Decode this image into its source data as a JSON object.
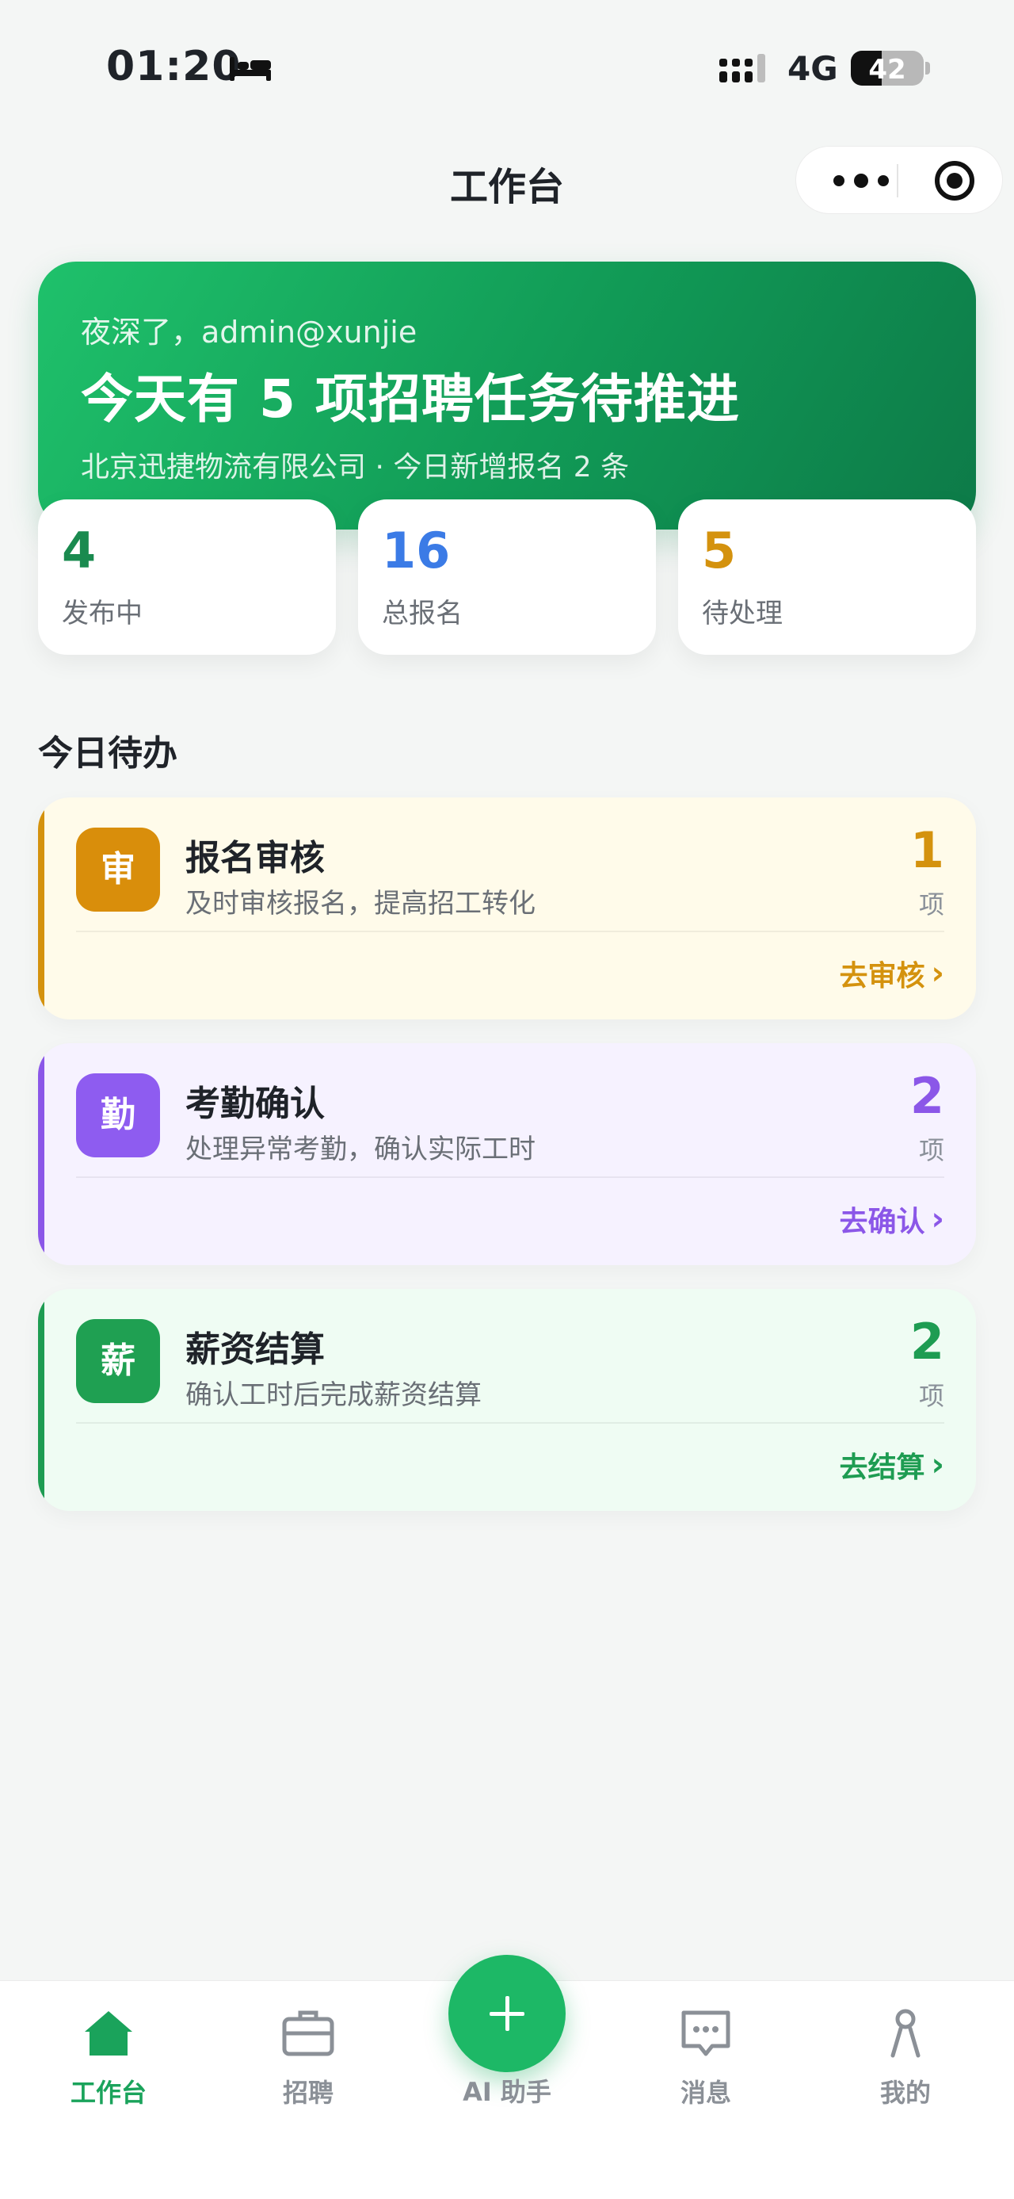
{
  "status_bar": {
    "time": "01:20",
    "sleep_icon": "bed-icon",
    "network": "4G",
    "battery": "42",
    "battery_level": 0.42
  },
  "nav": {
    "title": "工作台",
    "more_icon": "more-dots-icon",
    "target_icon": "record-target-icon"
  },
  "hero": {
    "greeting": "夜深了，admin@xunjie",
    "headline": "今天有 5 项招聘任务待推进",
    "subtitle": "北京迅捷物流有限公司 · 今日新增报名 2 条",
    "colors": {
      "start": "#1fc16b",
      "end": "#0d7a48"
    }
  },
  "stats": [
    {
      "value": "4",
      "label": "发布中",
      "color": "#1a8a4f"
    },
    {
      "value": "16",
      "label": "总报名",
      "color": "#3b7be6"
    },
    {
      "value": "5",
      "label": "待处理",
      "color": "#d4920e"
    }
  ],
  "todo": {
    "section_title": "今日待办",
    "cards": [
      {
        "badge": "审",
        "title": "报名审核",
        "desc": "及时审核报名，提高招工转化",
        "count": "1",
        "unit": "项",
        "action": "去审核",
        "accent": "#d4920e",
        "bg": "#fffbea",
        "badge_bg": "#d98e0b"
      },
      {
        "badge": "勤",
        "title": "考勤确认",
        "desc": "处理异常考勤，确认实际工时",
        "count": "2",
        "unit": "项",
        "action": "去确认",
        "accent": "#8b57e8",
        "bg": "#f6f2ff",
        "badge_bg": "#8e5cf0"
      },
      {
        "badge": "薪",
        "title": "薪资结算",
        "desc": "确认工时后完成薪资结算",
        "count": "2",
        "unit": "项",
        "action": "去结算",
        "accent": "#1e9c52",
        "bg": "#effcf3",
        "badge_bg": "#1fa052"
      }
    ]
  },
  "tabbar": {
    "tabs": [
      {
        "label": "工作台",
        "icon": "home-icon",
        "active": true
      },
      {
        "label": "招聘",
        "icon": "briefcase-icon",
        "active": false
      },
      {
        "label": "AI 助手",
        "icon": "plus-icon",
        "active": false
      },
      {
        "label": "消息",
        "icon": "chat-bubble-icon",
        "active": false
      },
      {
        "label": "我的",
        "icon": "person-icon",
        "active": false
      }
    ],
    "active_color": "#1aa35b",
    "inactive_color": "#8b9097"
  }
}
